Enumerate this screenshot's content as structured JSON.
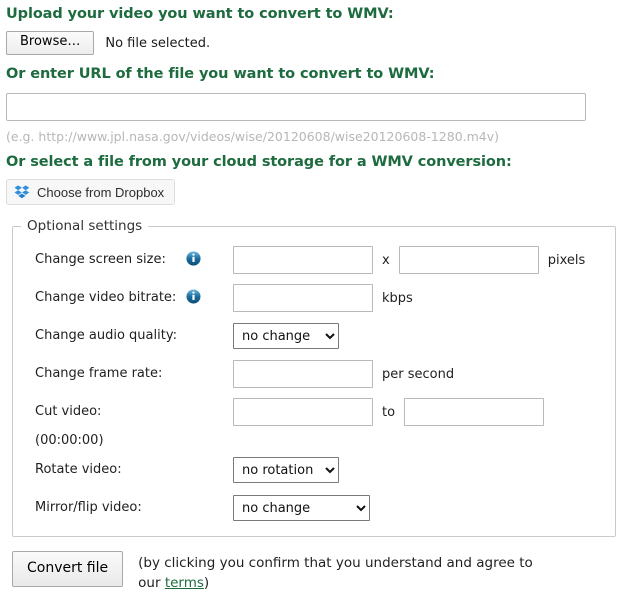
{
  "upload": {
    "heading": "Upload your video you want to convert to WMV:",
    "browse_label": "Browse…",
    "no_file_text": "No file selected."
  },
  "url": {
    "heading": "Or enter URL of the file you want to convert to WMV:",
    "value": "",
    "placeholder": "",
    "hint": "(e.g. http://www.jpl.nasa.gov/videos/wise/20120608/wise20120608-1280.m4v)"
  },
  "cloud": {
    "heading": "Or select a file from your cloud storage for a WMV conversion:",
    "dropbox_label": "Choose from Dropbox",
    "dropbox_icon": "dropbox-icon"
  },
  "optional": {
    "legend": "Optional settings",
    "info_icon": "info-icon",
    "rows": [
      {
        "label": "Change screen size:",
        "has_info": true,
        "width_value": "",
        "separator": "x",
        "height_value": "",
        "unit": "pixels"
      },
      {
        "label": "Change video bitrate:",
        "has_info": true,
        "value": "",
        "unit": "kbps"
      },
      {
        "label": "Change audio quality:",
        "has_info": false,
        "selected": "no change",
        "options": [
          "no change"
        ]
      },
      {
        "label": "Change frame rate:",
        "has_info": false,
        "value": "",
        "unit": "per second"
      },
      {
        "label": "Cut video:",
        "has_info": false,
        "from_value": "",
        "separator": "to",
        "to_value": "",
        "note": "(00:00:00)"
      },
      {
        "label": "Rotate video:",
        "has_info": false,
        "selected": "no rotation",
        "options": [
          "no rotation"
        ]
      },
      {
        "label": "Mirror/flip video:",
        "has_info": false,
        "selected": "no change",
        "options": [
          "no change"
        ]
      }
    ]
  },
  "convert": {
    "button_label": "Convert file",
    "confirm_prefix": "(by clicking you confirm that you understand and agree to our ",
    "terms_label": "terms",
    "confirm_suffix": ")"
  },
  "colors": {
    "heading_green": "#1d6b3f",
    "link_green": "#1d6b3f",
    "hint_gray": "#b7b7b7",
    "dropbox_blue": "#1e8fe1",
    "info_blue": "#0f6fa8"
  }
}
